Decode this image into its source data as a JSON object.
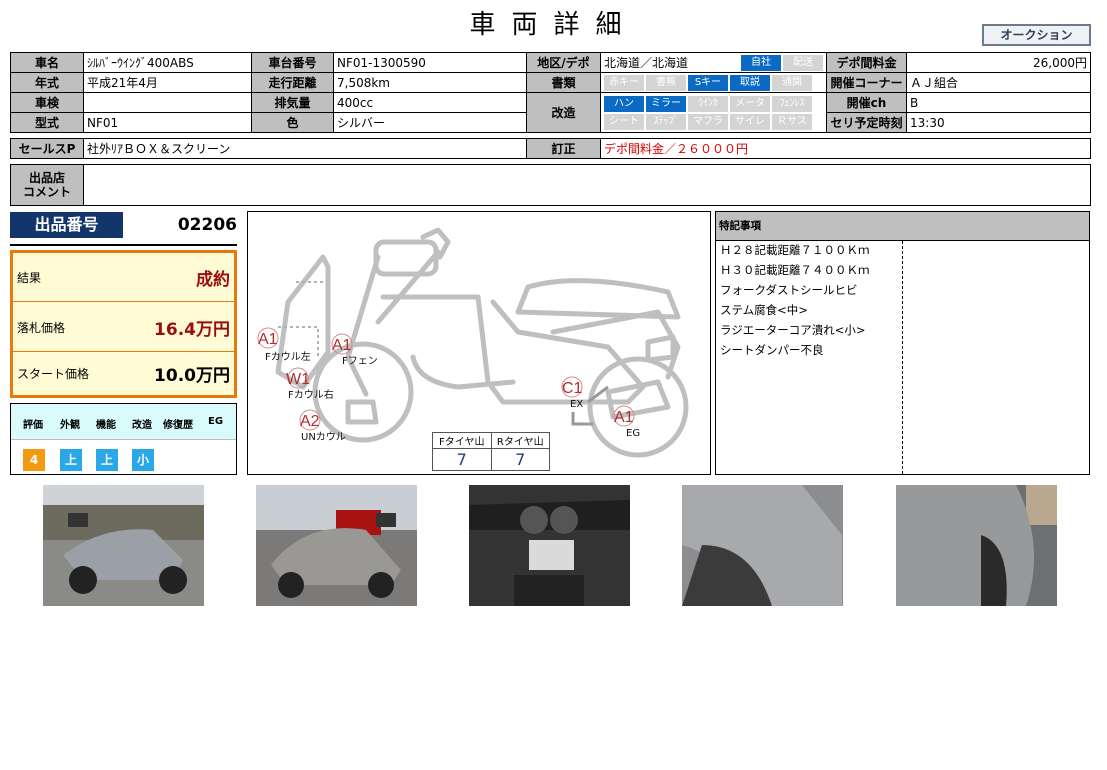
{
  "header": {
    "title": "車両詳細",
    "auction_label": "オークション"
  },
  "vehicle": {
    "name_label": "車名",
    "name": "ｼﾙﾊﾞｰｳｲﾝｸﾞ400ABS",
    "chassis_label": "車台番号",
    "chassis": "NF01-1300590",
    "region_label": "地区/デポ",
    "region": "北海道／北海道",
    "region_chips": [
      {
        "label": "自社",
        "on": true
      },
      {
        "label": "配送",
        "on": false
      }
    ],
    "depot_fee_label": "デポ間料金",
    "depot_fee": "26,000円",
    "year_label": "年式",
    "year": "平成21年4月",
    "mileage_label": "走行距離",
    "mileage": "7,508km",
    "docs_label": "書類",
    "docs_chips": [
      {
        "label": "赤キー",
        "on": false
      },
      {
        "label": "書無",
        "on": false
      },
      {
        "label": "Sキー",
        "on": true
      },
      {
        "label": "取説",
        "on": true
      },
      {
        "label": "通関",
        "on": false
      }
    ],
    "corner_label": "開催コーナー",
    "corner": "ＡＪ組合",
    "inspection_label": "車検",
    "inspection": "",
    "displacement_label": "排気量",
    "displacement": "400cc",
    "mod_label": "改造",
    "mod_chips_row1": [
      {
        "label": "ハン",
        "on": true
      },
      {
        "label": "ミラー",
        "on": true
      },
      {
        "label": "ｳｲﾝｶ",
        "on": false
      },
      {
        "label": "メータ",
        "on": false
      },
      {
        "label": "ﾌｪﾝﾚｽ",
        "on": false
      }
    ],
    "mod_chips_row2": [
      {
        "label": "シート",
        "on": false
      },
      {
        "label": "ｽﾃｯﾌﾟ",
        "on": false
      },
      {
        "label": "マフラ",
        "on": false
      },
      {
        "label": "サイレ",
        "on": false
      },
      {
        "label": "Ｒサス",
        "on": false
      }
    ],
    "channel_label": "開催ch",
    "channel": "B",
    "model_label": "型式",
    "model": "NF01",
    "color_label": "色",
    "color": "シルバー",
    "auction_time_label": "セリ予定時刻",
    "auction_time": "13:30",
    "salespoint_label": "セールスP",
    "salespoint": "社外ﾘｱＢＯＸ＆スクリーン",
    "correction_label": "訂正",
    "correction": "デポ間料金／２６０００円",
    "seller_comment_label_1": "出品店",
    "seller_comment_label_2": "コメント",
    "seller_comment": ""
  },
  "lot": {
    "label": "出品番号",
    "number": "02206"
  },
  "result": {
    "result_label": "結果",
    "result_value": "成約",
    "winning_label": "落札価格",
    "winning_value": "16.4万円",
    "start_label": "スタート価格",
    "start_value": "10.0万円"
  },
  "evaluation": {
    "headers": [
      "評価",
      "外観",
      "機能",
      "改造",
      "修復歴",
      "EG"
    ],
    "values": [
      {
        "text": "4",
        "color": "#f39a11"
      },
      {
        "text": "上",
        "color": "#29a7e6"
      },
      {
        "text": "上",
        "color": "#29a7e6"
      },
      {
        "text": "小",
        "color": "#29a7e6"
      }
    ]
  },
  "diagram": {
    "marks": [
      {
        "code": "A1",
        "label": "Fカウル左"
      },
      {
        "code": "A1",
        "label": "Fフェン"
      },
      {
        "code": "W1",
        "label": "Fカウル右"
      },
      {
        "code": "A2",
        "label": "UNカウル"
      },
      {
        "code": "C1",
        "label": "EX"
      },
      {
        "code": "A1",
        "label": "EG"
      }
    ],
    "tyre_f_label": "Fタイヤ山",
    "tyre_f": "7",
    "tyre_r_label": "Rタイヤ山",
    "tyre_r": "7"
  },
  "notes": {
    "title": "特記事項",
    "items": [
      "Ｈ２８記載距離７１００Ｋｍ",
      "Ｈ３０記載距離７４００Ｋｍ",
      "フォークダストシールヒビ",
      "ステム腐食<中>",
      "ラジエーターコア潰れ<小>",
      "シートダンパー不良"
    ]
  },
  "colors": {
    "navy": "#12356b",
    "orange": "#e87a0c",
    "blue_chip": "#0b6bc4",
    "red": "#e00000",
    "dark_red": "#9b0d0d"
  }
}
